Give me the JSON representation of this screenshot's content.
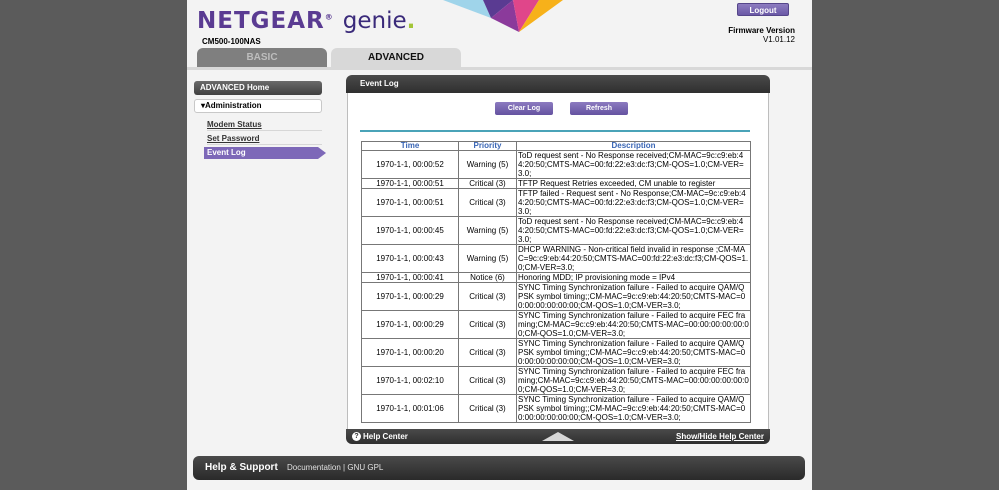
{
  "header": {
    "brand": "NETGEAR",
    "brand_suffix": "genie",
    "model": "CM500-100NAS",
    "logout_label": "Logout",
    "firmware_label": "Firmware Version",
    "firmware_value": "V1.01.12"
  },
  "tabs": [
    {
      "label": "BASIC",
      "active": false
    },
    {
      "label": "ADVANCED",
      "active": true
    }
  ],
  "sidebar": {
    "home": "ADVANCED Home",
    "section": "Administration",
    "items": [
      "Modem Status",
      "Set Password",
      "Event Log"
    ],
    "active_item": "Event Log"
  },
  "panel": {
    "title": "Event Log",
    "clear_label": "Clear Log",
    "refresh_label": "Refresh",
    "columns": [
      "Time",
      "Priority",
      "Description"
    ],
    "rows": [
      {
        "time": "1970-1-1, 00:00:52",
        "priority": "Warning (5)",
        "description": "ToD request sent - No Response received;CM-MAC=9c:c9:eb:44:20:50;CMTS-MAC=00:fd:22:e3:dc:f3;CM-QOS=1.0;CM-VER=3.0;"
      },
      {
        "time": "1970-1-1, 00:00:51",
        "priority": "Critical (3)",
        "description": "TFTP Request Retries exceeded, CM unable to register"
      },
      {
        "time": "1970-1-1, 00:00:51",
        "priority": "Critical (3)",
        "description": "TFTP failed - Request sent - No Response;CM-MAC=9c:c9:eb:44:20:50;CMTS-MAC=00:fd:22:e3:dc:f3;CM-QOS=1.0;CM-VER=3.0;"
      },
      {
        "time": "1970-1-1, 00:00:45",
        "priority": "Warning (5)",
        "description": "ToD request sent - No Response received;CM-MAC=9c:c9:eb:44:20:50;CMTS-MAC=00:fd:22:e3:dc:f3;CM-QOS=1.0;CM-VER=3.0;"
      },
      {
        "time": "1970-1-1, 00:00:43",
        "priority": "Warning (5)",
        "description": "DHCP WARNING - Non-critical field invalid in response ;CM-MAC=9c:c9:eb:44:20:50;CMTS-MAC=00:fd:22:e3:dc:f3;CM-QOS=1.0;CM-VER=3.0;"
      },
      {
        "time": "1970-1-1, 00:00:41",
        "priority": "Notice (6)",
        "description": "Honoring MDD; IP provisioning mode = IPv4"
      },
      {
        "time": "1970-1-1, 00:00:29",
        "priority": "Critical (3)",
        "description": "SYNC Timing Synchronization failure - Failed to acquire QAM/QPSK symbol timing;;CM-MAC=9c:c9:eb:44:20:50;CMTS-MAC=00:00:00:00:00:00;CM-QOS=1.0;CM-VER=3.0;"
      },
      {
        "time": "1970-1-1, 00:00:29",
        "priority": "Critical (3)",
        "description": "SYNC Timing Synchronization failure - Failed to acquire FEC framing;CM-MAC=9c:c9:eb:44:20:50;CMTS-MAC=00:00:00:00:00:00;CM-QOS=1.0;CM-VER=3.0;"
      },
      {
        "time": "1970-1-1, 00:00:20",
        "priority": "Critical (3)",
        "description": "SYNC Timing Synchronization failure - Failed to acquire QAM/QPSK symbol timing;;CM-MAC=9c:c9:eb:44:20:50;CMTS-MAC=00:00:00:00:00:00;CM-QOS=1.0;CM-VER=3.0;"
      },
      {
        "time": "1970-1-1, 00:02:10",
        "priority": "Critical (3)",
        "description": "SYNC Timing Synchronization failure - Failed to acquire FEC framing;CM-MAC=9c:c9:eb:44:20:50;CMTS-MAC=00:00:00:00:00:00;CM-QOS=1.0;CM-VER=3.0;"
      },
      {
        "time": "1970-1-1, 00:01:06",
        "priority": "Critical (3)",
        "description": "SYNC Timing Synchronization failure - Failed to acquire QAM/QPSK symbol timing;;CM-MAC=9c:c9:eb:44:20:50;CMTS-MAC=00:00:00:00:00:00;CM-QOS=1.0;CM-VER=3.0;"
      }
    ],
    "help_center_label": "Help Center",
    "toggle_help_label": "Show/Hide Help Center"
  },
  "footer": {
    "title": "Help & Support",
    "documentation": "Documentation",
    "separator": "|",
    "gpl": "GNU GPL"
  }
}
